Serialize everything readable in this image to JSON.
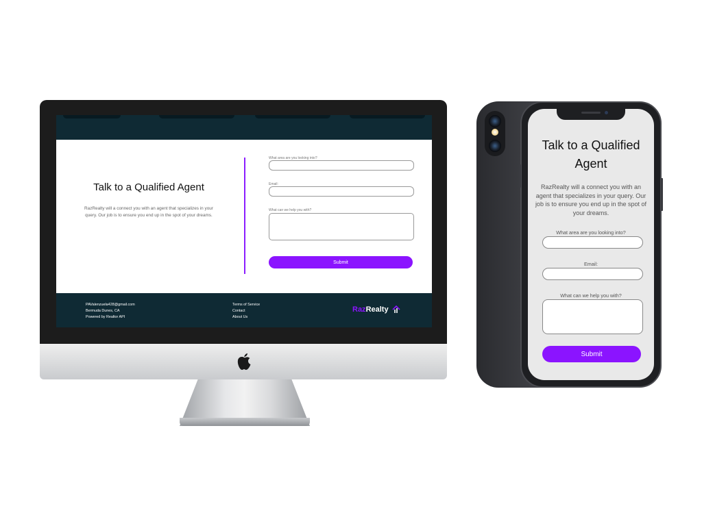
{
  "desktop": {
    "title": "Talk to a Qualified Agent",
    "description": "RazRealty will a connect you with an agent that specializes in your query. Our job is to ensure you end up in the spot of your dreams.",
    "form": {
      "area_label": "What area are you looking into?",
      "email_label": "Email:",
      "help_label": "What can we help you with?",
      "submit_label": "Submit"
    },
    "footer": {
      "contact": [
        "PAValenzuela428@gmail.com",
        "Bermuda Dunes, CA",
        "Powered by Realtor API"
      ],
      "links": [
        "Terms of Service",
        "Contact",
        "About Us"
      ],
      "logo_part1": "Raz",
      "logo_part2": "Realty"
    }
  },
  "mobile": {
    "title": "Talk to a Qualified Agent",
    "description": "RazRealty will a connect you with an agent that specializes in your query. Our job is to ensure you end up in the spot of your dreams.",
    "form": {
      "area_label": "What area are you looking into?",
      "email_label": "Email:",
      "help_label": "What can we help you with?",
      "submit_label": "Submit"
    }
  },
  "colors": {
    "accent": "#8b14ff",
    "header_bg": "#0f2a34",
    "bezel": "#1c1c1c"
  },
  "icons": {
    "apple": "apple-logo-icon",
    "brand": "house-arrow-icon"
  }
}
